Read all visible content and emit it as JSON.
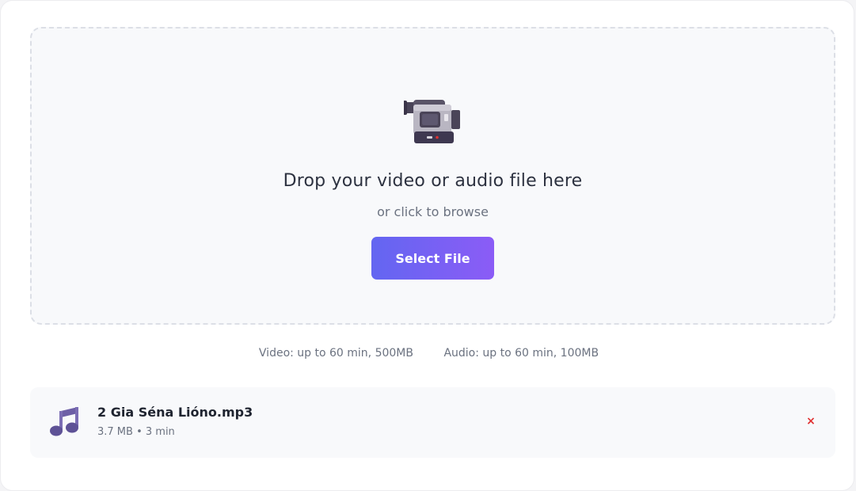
{
  "upload": {
    "icon": "video-camera-icon",
    "title": "Drop your video or audio file here",
    "subtitle": "or click to browse",
    "button_label": "Select File",
    "button_colors": [
      "#6366f1",
      "#8b5cf6"
    ]
  },
  "limits": {
    "video": "Video: up to 60 min, 500MB",
    "audio": "Audio: up to 60 min, 100MB"
  },
  "file": {
    "icon": "music-note-icon",
    "name": "2 Gia Séna Lióno.mp3",
    "meta": "3.7 MB • 3 min",
    "remove_label": "×",
    "remove_color": "#e03131"
  }
}
